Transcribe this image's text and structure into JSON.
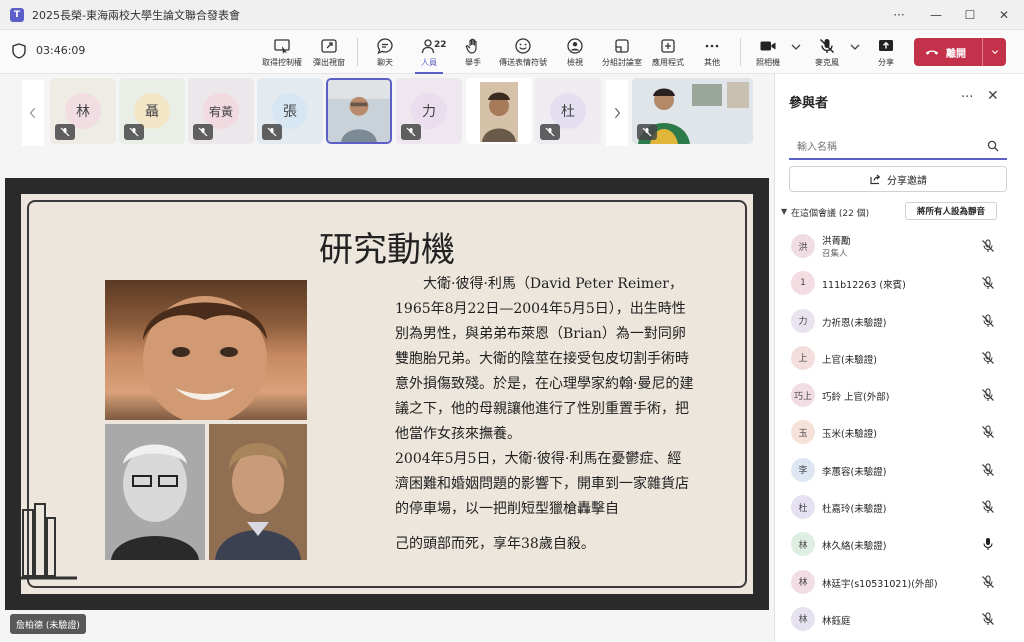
{
  "window": {
    "title": "2025長榮-東海兩校大學生論文聯合發表會",
    "logo_letter": "T",
    "controls": [
      "···",
      "—",
      "☐",
      "✕"
    ]
  },
  "toolbar": {
    "timer": "03:46:09",
    "people_count": "22",
    "buttons": [
      {
        "label": "取得控制權",
        "icon": "take-control-icon"
      },
      {
        "label": "彈出視窗",
        "icon": "popout-icon"
      },
      {
        "label": "聊天",
        "icon": "chat-icon"
      },
      {
        "label": "人員",
        "icon": "people-icon"
      },
      {
        "label": "舉手",
        "icon": "raise-hand-icon"
      },
      {
        "label": "傳送表情符號",
        "icon": "emoji-icon"
      },
      {
        "label": "檢視",
        "icon": "view-icon"
      },
      {
        "label": "分組討論室",
        "icon": "breakout-icon"
      },
      {
        "label": "應用程式",
        "icon": "apps-icon"
      },
      {
        "label": "其他",
        "icon": "more-icon"
      },
      {
        "label": "照相機",
        "icon": "camera-icon"
      },
      {
        "label": "麥克風",
        "icon": "mic-off-icon"
      },
      {
        "label": "分享",
        "icon": "share-icon"
      }
    ],
    "leave_label": "離開"
  },
  "strip": {
    "tiles": [
      {
        "initial": "林",
        "bg": "#efece6",
        "avbg": "#f2dde3"
      },
      {
        "initial": "聶",
        "bg": "#e9efe6",
        "avbg": "#f3e6c6"
      },
      {
        "initial": "宥黃",
        "bg": "#ece7ea",
        "avbg": "#f1dbe0"
      },
      {
        "initial": "張",
        "bg": "#e3eaf0",
        "avbg": "#d7e6f3"
      },
      {
        "initial": "",
        "bg": "#b8c4cc",
        "avbg": "",
        "video": true
      },
      {
        "initial": "力",
        "bg": "#efe7f0",
        "avbg": "#e9ddee"
      },
      {
        "initial": "",
        "bg": "#ffffff",
        "avbg": "",
        "video": true
      },
      {
        "initial": "杜",
        "bg": "#eeebf1",
        "avbg": "#e3dff0"
      }
    ]
  },
  "slide": {
    "title": "研究動機",
    "paragraph1": "大衛·彼得·利馬（David Peter Reimer，1965年8月22日—2004年5月5日），出生時性別為男性，與弟弟布萊恩（Brian）為一對同卵雙胞胎兄弟。大衛的陰莖在接受包皮切割手術時意外損傷致殘。於是，在心理學家約翰·曼尼的建議之下，他的母親讓他進行了性別重置手術，把他當作女孩來撫養。",
    "paragraph2": "2004年5月5日，大衛·彼得·利馬在憂鬱症、經濟困難和婚姻問題的影響下，開車到一家雜貨店的停車場，以一把削短型獵槍轟擊自",
    "paragraph3": "己的頭部而死，享年38歲自殺。"
  },
  "speaker_badge": "詹柏德 (未驗證)",
  "panel": {
    "title": "參與者",
    "search_placeholder": "輸入名稱",
    "share_invite": "分享邀請",
    "section_title": "在這個會議 (22 個)",
    "mute_all": "將所有人設為靜音",
    "participants": [
      {
        "initial": "洪",
        "name": "洪菁勵",
        "role": "召集人",
        "avbg": "#f0dde4",
        "mic": "muted"
      },
      {
        "initial": "1",
        "name": "111b12263 (來賓)",
        "role": "",
        "avbg": "#f3dde3",
        "mic": "muted"
      },
      {
        "initial": "力",
        "name": "力祈恩(未驗證)",
        "role": "",
        "avbg": "#e8e3ee",
        "mic": "muted"
      },
      {
        "initial": "上",
        "name": "上官(未驗證)",
        "role": "",
        "avbg": "#f3dedd",
        "mic": "muted"
      },
      {
        "initial": "巧上",
        "name": "巧鈴 上官(外部)",
        "role": "",
        "avbg": "#f3dde4",
        "mic": "muted"
      },
      {
        "initial": "玉",
        "name": "玉米(未驗證)",
        "role": "",
        "avbg": "#f6e2d8",
        "mic": "muted"
      },
      {
        "initial": "李",
        "name": "李蕙容(未驗證)",
        "role": "",
        "avbg": "#dde6f1",
        "mic": "muted"
      },
      {
        "initial": "杜",
        "name": "杜嘉玲(未驗證)",
        "role": "",
        "avbg": "#e6e1f0",
        "mic": "muted"
      },
      {
        "initial": "林",
        "name": "林久絡(未驗證)",
        "role": "",
        "avbg": "#dfeee2",
        "mic": "on"
      },
      {
        "initial": "林",
        "name": "林廷宇(s10531021)(外部)",
        "role": "",
        "avbg": "#f2dde3",
        "mic": "muted"
      },
      {
        "initial": "林",
        "name": "林鈺庭",
        "role": "",
        "avbg": "#e6e1ee",
        "mic": "muted"
      }
    ]
  },
  "colors": {
    "accent": "#5b5fc7",
    "leave": "#c4314b"
  }
}
